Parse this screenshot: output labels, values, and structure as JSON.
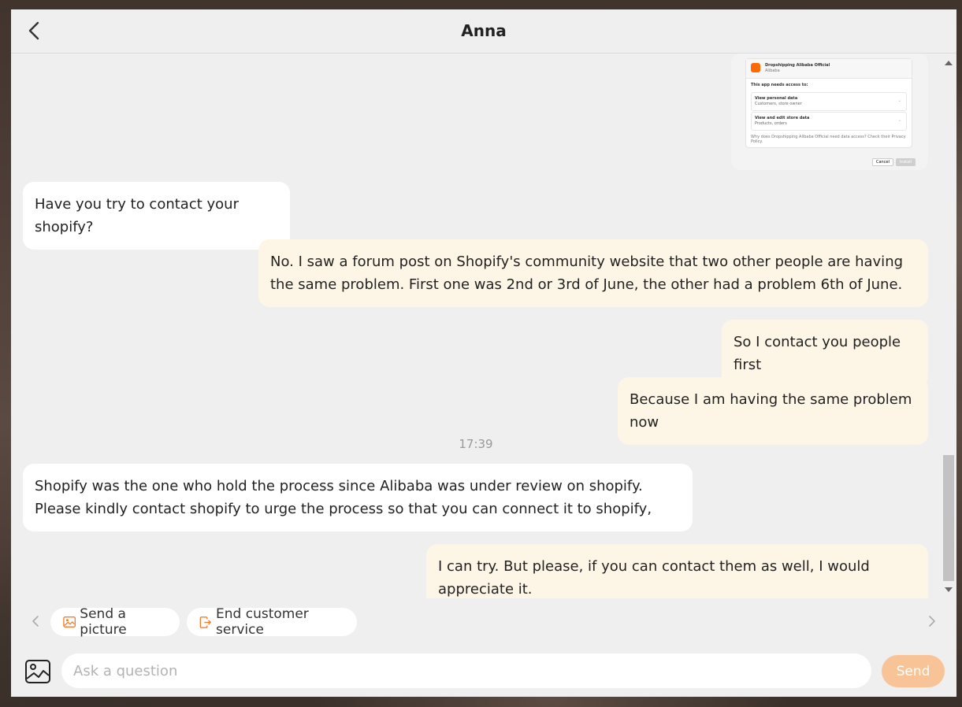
{
  "header": {
    "title": "Anna"
  },
  "screenshot_card": {
    "app_name": "Dropshipping Alibaba Official",
    "app_sub": "Alibaba",
    "needs_access": "This app needs access to:",
    "row1_title": "View personal data",
    "row1_sub": "Customers, store owner",
    "row2_title": "View and edit store data",
    "row2_sub": "Products, orders",
    "why_text": "Why does Dropshipping Alibaba Official need data access? Check their Privacy Policy.",
    "cancel_label": "Cancel",
    "install_label": "Install"
  },
  "messages": [
    {
      "from": "agent",
      "text": "Have you try to contact your shopify?"
    },
    {
      "from": "user",
      "text": "No. I saw a forum post on Shopify's community website that two other people are having the same problem. First one was 2nd or 3rd of June, the other had a problem 6th of June."
    },
    {
      "from": "user",
      "text": "So I contact you people first"
    },
    {
      "from": "user",
      "text": "Because I am having the same problem now"
    },
    {
      "from": "agent",
      "text": "Shopify was the one who hold the process since Alibaba was under review on shopify. Please kindly contact shopify to urge the process so that you can connect it to shopify,"
    },
    {
      "from": "user",
      "text": "I can try. But please, if you can contact them as well, I would appreciate it."
    }
  ],
  "timestamp": "17:39",
  "quick_actions": [
    {
      "label": "Send a picture",
      "icon": "picture-icon"
    },
    {
      "label": "End customer service",
      "icon": "exit-icon"
    }
  ],
  "input": {
    "placeholder": "Ask a question",
    "value": ""
  },
  "send_label": "Send",
  "colors": {
    "accent": "#f47d30",
    "send_button": "#f8c497",
    "user_bubble": "#fdf6e6",
    "agent_bubble": "#ffffff",
    "window_bg": "#efefef"
  }
}
